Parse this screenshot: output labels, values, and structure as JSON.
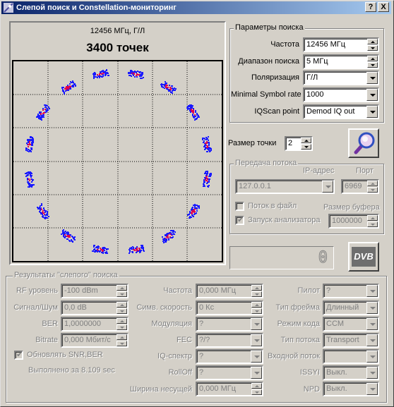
{
  "window": {
    "title": "Слепой поиск и Constellation-мониторинг",
    "help_btn": "?",
    "close_btn": "X"
  },
  "plot": {
    "freq_label": "12456 МГц, Г/Л",
    "points_label": "3400 точек"
  },
  "search_params": {
    "title": "Параметры поиска",
    "frequency_label": "Частота",
    "frequency_value": "12456 МГц",
    "range_label": "Диапазон поиска",
    "range_value": "5 МГц",
    "polarization_label": "Поляризация",
    "polarization_value": "Г/Л",
    "min_sr_label": "Minimal Symbol rate",
    "min_sr_value": "1000",
    "iqscan_label": "IQScan point",
    "iqscan_value": "Demod IQ out"
  },
  "point_size": {
    "label": "Размер точки",
    "value": "2"
  },
  "stream": {
    "title": "Передача потока",
    "ip_label": "IP-адрес",
    "ip_value": "127.0.0.1",
    "port_label": "Порт",
    "port_value": "6969",
    "to_file_label": "Поток в файл",
    "run_analyzer_label": "Запуск анализатора",
    "buffer_label": "Размер буфера",
    "buffer_value": "1000000"
  },
  "counter": {
    "value": "0"
  },
  "dvb_logo": "DVB",
  "results": {
    "title": "Результаты \"слепого\" поиска",
    "rf_label": "RF уровень",
    "rf_value": "-100 dBm",
    "snr_label": "Сигнал/Шум",
    "snr_value": "0,0 dB",
    "ber_label": "BER",
    "ber_value": "1,0000000",
    "bitrate_label": "Bitrate",
    "bitrate_value": "0,000 Мбит/с",
    "update_label": "Обновлять SNR,BER",
    "done_text": "Выполнено за 8.109 sec",
    "freq_label": "Частота",
    "freq_value": "0,000 МГц",
    "sym_label": "Симв. скорость",
    "sym_value": "0 Кс",
    "mod_label": "Модуляция",
    "mod_value": "?",
    "fec_label": "FEC",
    "fec_value": "?/?",
    "iq_label": "IQ-спектр",
    "iq_value": "?",
    "rolloff_label": "RollOff",
    "rolloff_value": "?",
    "bw_label": "Ширина несущей",
    "bw_value": "0,000 МГц",
    "pilot_label": "Пилот",
    "pilot_value": "?",
    "frame_label": "Тип фрейма",
    "frame_value": "Длинный",
    "code_label": "Режим кода",
    "code_value": "CCM",
    "stream_type_label": "Тип потока",
    "stream_type_value": "Transport",
    "input_label": "Входной поток",
    "input_value": "",
    "issyi_label": "ISSYI",
    "issyi_value": "Выкл.",
    "npd_label": "NPD",
    "npd_value": "Выкл."
  },
  "colors": {
    "title_start": "#0a246a",
    "title_end": "#a6caf0",
    "point_blue": "#1a1aff",
    "point_red": "#e0004a",
    "grid": "#000000"
  }
}
